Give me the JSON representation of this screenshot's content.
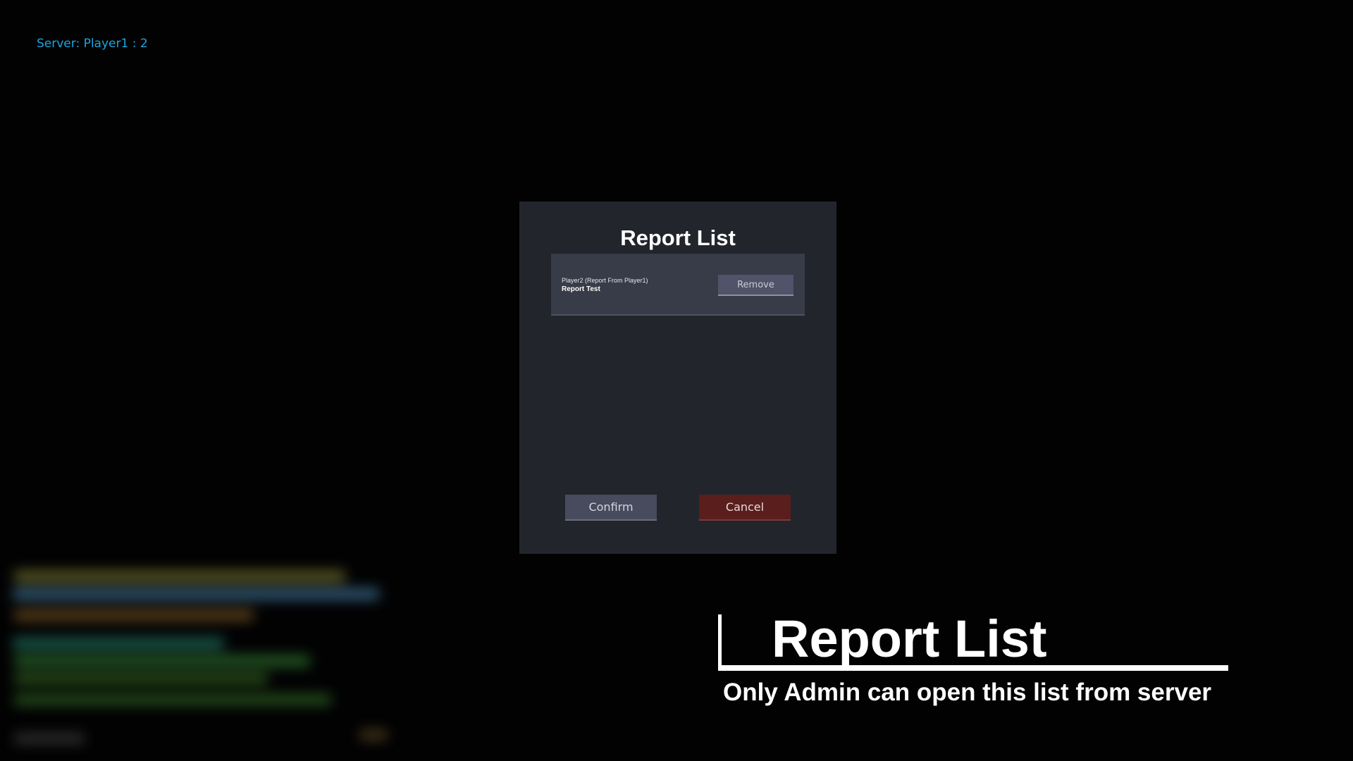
{
  "server_status": {
    "text": "Server: Player1 :  2"
  },
  "dialog": {
    "title": "Report List",
    "reports": [
      {
        "header": "Player2 (Report From Player1)",
        "message": "Report Test",
        "remove_label": "Remove"
      }
    ],
    "confirm_label": "Confirm",
    "cancel_label": "Cancel"
  },
  "caption": {
    "title": "Report List",
    "subtitle": "Only Admin can open this list from server"
  },
  "colors": {
    "background": "#020203",
    "dialog_bg": "#22252c",
    "item_bg": "#383b48",
    "server_text": "#1aa6e0",
    "cancel_bg": "#5a1e1c",
    "confirm_bg": "#484b5d"
  }
}
